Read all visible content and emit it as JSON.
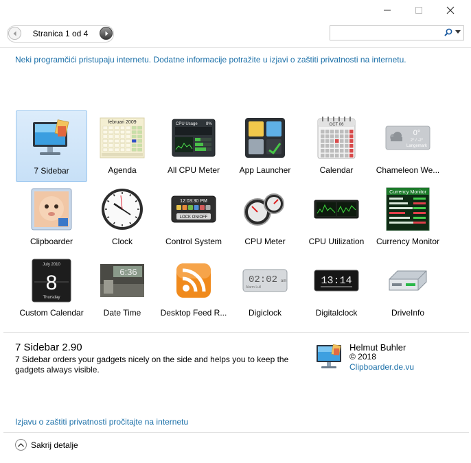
{
  "window": {
    "minimize_icon": "minimize-icon",
    "maximize_icon": "maximize-icon",
    "close_icon": "close-icon"
  },
  "nav": {
    "page_text": "Stranica 1 od 4",
    "prev_icon": "chevron-left-icon",
    "next_icon": "chevron-right-icon"
  },
  "search": {
    "value": "",
    "placeholder": "",
    "icon": "search-icon",
    "dropdown_icon": "chevron-down-icon"
  },
  "privacy_notice": "Neki programčići pristupaju internetu. Dodatne informacije potražite u izjavi o zaštiti privatnosti na internetu.",
  "gadgets": [
    {
      "label": "7 Sidebar",
      "icon": "monitor-sidebar-icon",
      "selected": true
    },
    {
      "label": "Agenda",
      "icon": "calendar-agenda-icon"
    },
    {
      "label": "All CPU Meter",
      "icon": "cpu-meter-icon"
    },
    {
      "label": "App Launcher",
      "icon": "app-launcher-icon"
    },
    {
      "label": "Calendar",
      "icon": "calendar-icon"
    },
    {
      "label": "Chameleon We...",
      "icon": "weather-icon"
    },
    {
      "label": "Clipboarder",
      "icon": "baby-photo-icon"
    },
    {
      "label": "Clock",
      "icon": "clock-icon"
    },
    {
      "label": "Control System",
      "icon": "control-system-icon"
    },
    {
      "label": "CPU Meter",
      "icon": "cpu-gauge-icon"
    },
    {
      "label": "CPU Utilization",
      "icon": "cpu-utilization-icon"
    },
    {
      "label": "Currency Monitor",
      "icon": "currency-monitor-icon"
    },
    {
      "label": "Custom Calendar",
      "icon": "custom-calendar-icon"
    },
    {
      "label": "Date Time",
      "icon": "date-time-icon"
    },
    {
      "label": "Desktop Feed R...",
      "icon": "rss-feed-icon"
    },
    {
      "label": "Digiclock",
      "icon": "digital-clock-icon"
    },
    {
      "label": "Digitalclock",
      "icon": "digital-clock-black-icon"
    },
    {
      "label": "DriveInfo",
      "icon": "drive-icon"
    }
  ],
  "thumb_text": {
    "agenda_month": "februari 2009",
    "cpu_title": "CPU Usage",
    "cpu_pct": "8%",
    "calendar_month": "OCT 06",
    "weather_temp": "0°",
    "weather_range": "2° / -2°",
    "weather_city": "Langemark",
    "control_time": "12:03:30 PM",
    "control_lock": "LOCK ON/OFF",
    "currency_title": "Currency Monitor",
    "custom_cal_month": "July 2010",
    "custom_cal_day": "8",
    "custom_cal_weekday": "Thursday",
    "datetime_time": "6:36",
    "digiclock_time": "02:02",
    "digiclock_sub": "Alarm Lull",
    "digiclock_ampm": "am",
    "digitalclock_time": "13:14"
  },
  "details": {
    "title": "7 Sidebar 2.90",
    "description": "7 Sidebar orders your gadgets nicely on the side and helps you to keep the gadgets always visible.",
    "author": "Helmut Buhler",
    "copyright": "© 2018",
    "author_link": "Clipboarder.de.vu"
  },
  "privacy_link": "Izjavu o zaštiti privatnosti pročitajte na internetu",
  "toggle_details": "Sakrij detalje",
  "toggle_icon": "chevron-up-icon",
  "colors": {
    "link": "#1a6fa8",
    "selection": "#c7e0f7"
  }
}
